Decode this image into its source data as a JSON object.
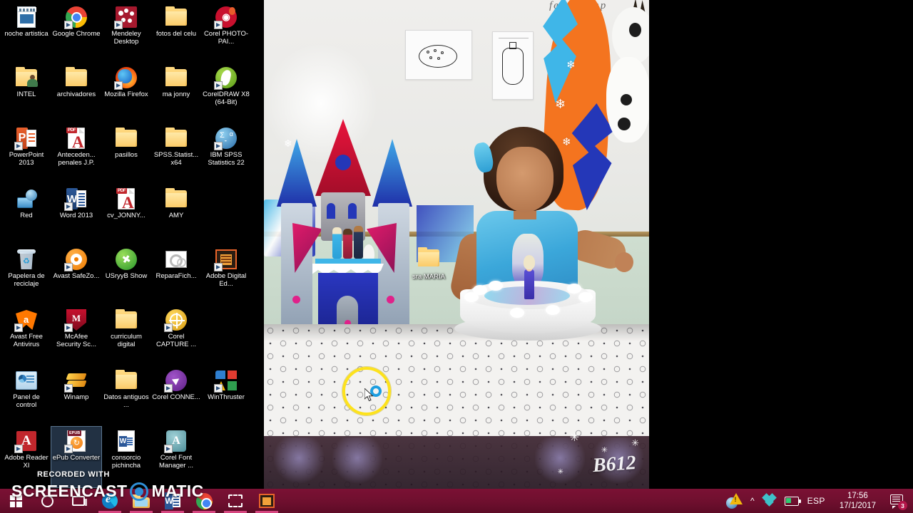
{
  "desktop": {
    "icons": [
      {
        "label": "noche artistica",
        "icon": "video-file-icon",
        "shortcut": false
      },
      {
        "label": "Google Chrome",
        "icon": "chrome-icon",
        "shortcut": true
      },
      {
        "label": "Mendeley Desktop",
        "icon": "mendeley-icon",
        "shortcut": true
      },
      {
        "label": "fotos del celu",
        "icon": "folder-icon",
        "shortcut": false
      },
      {
        "label": "Corel PHOTO-PAI...",
        "icon": "corel-photo-paint-icon",
        "shortcut": true
      },
      {
        "label": "INTEL",
        "icon": "folder-user-icon",
        "shortcut": false
      },
      {
        "label": "archivadores",
        "icon": "folder-icon",
        "shortcut": false
      },
      {
        "label": "Mozilla Firefox",
        "icon": "firefox-icon",
        "shortcut": true
      },
      {
        "label": "ma jonny",
        "icon": "folder-icon",
        "shortcut": false
      },
      {
        "label": "CorelDRAW X8 (64-Bit)",
        "icon": "coreldraw-icon",
        "shortcut": true
      },
      {
        "label": "PowerPoint 2013",
        "icon": "powerpoint-icon",
        "shortcut": true
      },
      {
        "label": "Anteceden... penales J.P.",
        "icon": "pdf-file-icon",
        "shortcut": false
      },
      {
        "label": "pasillos",
        "icon": "folder-icon",
        "shortcut": false
      },
      {
        "label": "SPSS.Statist... x64",
        "icon": "folder-icon",
        "shortcut": false
      },
      {
        "label": "IBM SPSS Statistics 22",
        "icon": "spss-icon",
        "shortcut": true
      },
      {
        "label": "Red",
        "icon": "network-icon",
        "shortcut": false
      },
      {
        "label": "Word 2013",
        "icon": "word-icon",
        "shortcut": true
      },
      {
        "label": "cv_JONNY...",
        "icon": "pdf-file-icon",
        "shortcut": false
      },
      {
        "label": "AMY",
        "icon": "folder-icon",
        "shortcut": false
      },
      {
        "label": "",
        "icon": "none",
        "shortcut": false
      },
      {
        "label": "Papelera de reciclaje",
        "icon": "recycle-bin-icon",
        "shortcut": false
      },
      {
        "label": "Avast SafeZo...",
        "icon": "avast-safezone-icon",
        "shortcut": true
      },
      {
        "label": "USryyB Show",
        "icon": "usryyb-show-icon",
        "shortcut": false
      },
      {
        "label": "ReparaFich...",
        "icon": "repair-files-icon",
        "shortcut": false
      },
      {
        "label": "Adobe Digital Ed...",
        "icon": "adobe-digital-editions-icon",
        "shortcut": true
      },
      {
        "label": "Avast Free Antivirus",
        "icon": "avast-free-icon",
        "shortcut": true
      },
      {
        "label": "McAfee Security Sc...",
        "icon": "mcafee-icon",
        "shortcut": true
      },
      {
        "label": "curriculum digital",
        "icon": "folder-icon",
        "shortcut": false
      },
      {
        "label": "Corel CAPTURE ...",
        "icon": "corel-capture-icon",
        "shortcut": true
      },
      {
        "label": "",
        "icon": "none",
        "shortcut": false
      },
      {
        "label": "Panel de control",
        "icon": "control-panel-icon",
        "shortcut": false
      },
      {
        "label": "Winamp",
        "icon": "winamp-icon",
        "shortcut": true
      },
      {
        "label": "Datos antiguos ...",
        "icon": "folder-icon",
        "shortcut": false
      },
      {
        "label": "Corel CONNE...",
        "icon": "corel-connect-icon",
        "shortcut": true
      },
      {
        "label": "WinThruster",
        "icon": "winthruster-icon",
        "shortcut": true
      },
      {
        "label": "Adobe Reader XI",
        "icon": "adobe-reader-icon",
        "shortcut": true
      },
      {
        "label": "ePub Converter",
        "icon": "epub-converter-icon",
        "shortcut": true,
        "selected": true
      },
      {
        "label": "consorcio pichincha",
        "icon": "word-doc-icon",
        "shortcut": false
      },
      {
        "label": "Corel Font Manager ...",
        "icon": "corel-font-manager-icon",
        "shortcut": true
      },
      {
        "label": "",
        "icon": "none",
        "shortcut": false
      }
    ],
    "overlay_icon": {
      "label": "sra MARIA",
      "icon": "folder-icon"
    }
  },
  "video": {
    "scene_description": "Child birthday video playing over desktop",
    "handwriting": "feliz cump",
    "watermark_b612": "B612"
  },
  "watermark": {
    "recorded_with": "RECORDED WITH",
    "brand_left": "SCREENCAST",
    "brand_right": "MATIC"
  },
  "taskbar": {
    "buttons": [
      {
        "name": "start-button",
        "icon": "windows-logo-icon"
      },
      {
        "name": "cortana-search-button",
        "icon": "cortana-icon"
      },
      {
        "name": "task-view-button",
        "icon": "task-view-icon"
      },
      {
        "name": "edge-button",
        "icon": "edge-icon"
      },
      {
        "name": "file-explorer-button",
        "icon": "file-explorer-icon"
      },
      {
        "name": "word-button",
        "icon": "word-icon"
      },
      {
        "name": "chrome-button",
        "icon": "chrome-icon"
      },
      {
        "name": "snipping-tool-button",
        "icon": "snipping-tool-icon"
      },
      {
        "name": "adobe-digital-editions-button",
        "icon": "adobe-digital-editions-icon"
      }
    ],
    "tray": {
      "action_center_count": "3",
      "language": "ESP",
      "time": "17:56",
      "date": "17/1/2017"
    }
  },
  "colors": {
    "taskbar": "#6e0f2e",
    "desktop_background": "#000000",
    "cursor_highlight": "#fde21c",
    "click_ring": "#1e9ee0",
    "selection": "#5a82af"
  }
}
